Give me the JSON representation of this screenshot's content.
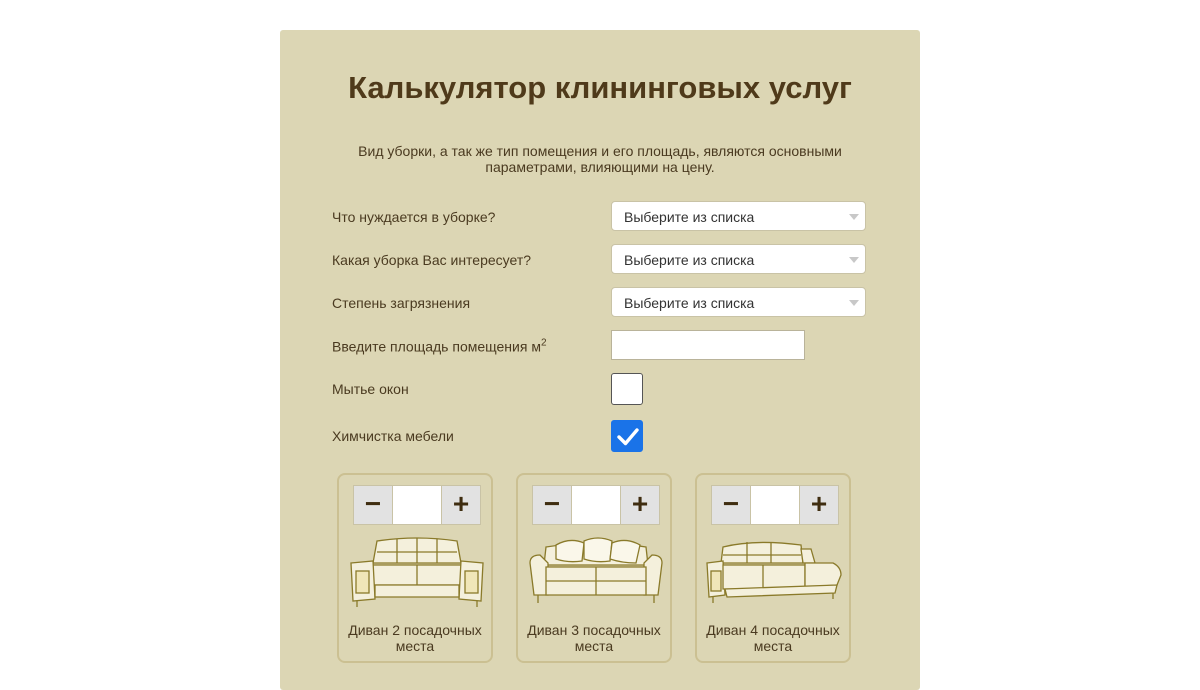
{
  "calculator": {
    "title": "Калькулятор клининговых услуг",
    "subtitle": "Вид уборки, а так же тип помещения и его площадь, являются основными параметрами, влияющими на цену.",
    "fields": [
      {
        "label": "Что нуждается в уборке?",
        "value": "Выберите из списка"
      },
      {
        "label": "Какая уборка Вас интересует?",
        "value": "Выберите из списка"
      },
      {
        "label": "Степень загрязнения",
        "value": "Выберите из списка"
      }
    ],
    "area": {
      "label": "Введите площадь помещения м",
      "unit_sup": "2",
      "value": ""
    },
    "windows": {
      "label": "Мытье окон",
      "checked": false
    },
    "furniture": {
      "label": "Химчистка мебели",
      "checked": true
    },
    "items": [
      {
        "name": "Диван 2 посадочных места",
        "minus": "−",
        "plus": "+",
        "qty": ""
      },
      {
        "name": "Диван 3 посадочных места",
        "minus": "−",
        "plus": "+",
        "qty": ""
      },
      {
        "name": "Диван 4 посадочных места",
        "minus": "−",
        "plus": "+",
        "qty": ""
      }
    ]
  },
  "colors": {
    "panel": "#dcd6b4",
    "title": "#4f3a1a",
    "checkbox_checked": "#1a73e8",
    "card_border": "#cbc092",
    "sofa_line": "#8a7a2a"
  },
  "icons": [
    "chevron-down-icon",
    "checkmark-icon",
    "minus-icon",
    "plus-icon",
    "sofa-icon"
  ]
}
